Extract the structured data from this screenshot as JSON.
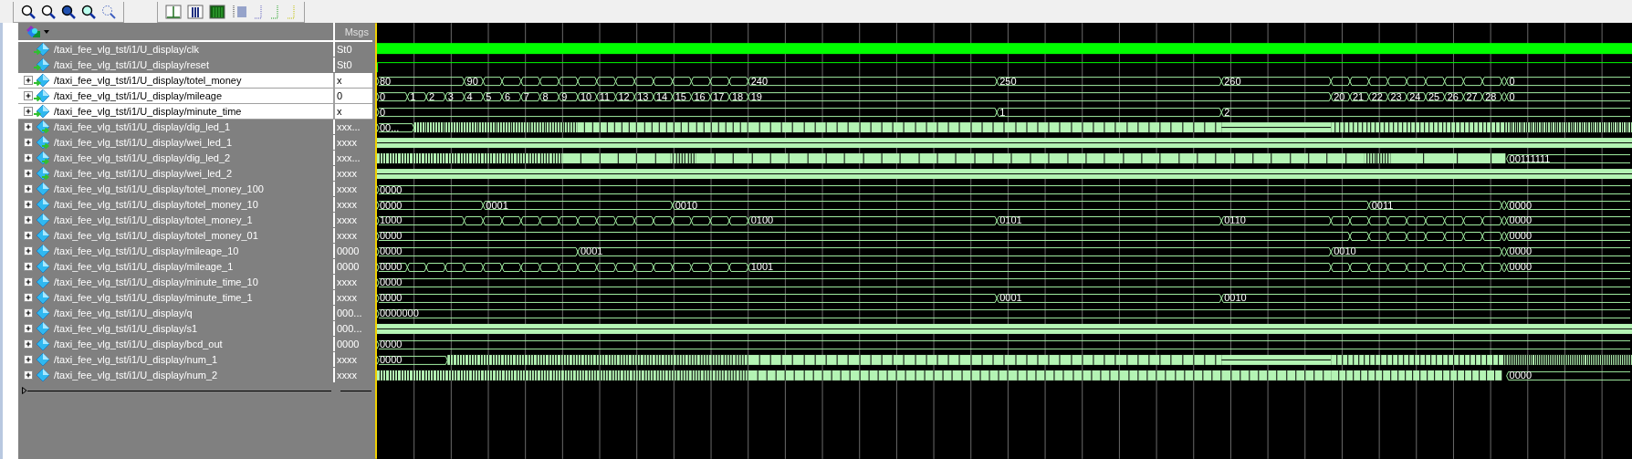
{
  "header": {
    "msgs_label": "Msgs"
  },
  "signals": [
    {
      "name": "/taxi_fee_vlg_tst/i1/U_display/clk",
      "value": "St0",
      "input": true,
      "output": false,
      "expandable": false,
      "selected": false,
      "kind": "clock"
    },
    {
      "name": "/taxi_fee_vlg_tst/i1/U_display/reset",
      "value": "St0",
      "input": true,
      "output": false,
      "expandable": false,
      "selected": false,
      "kind": "bit"
    },
    {
      "name": "/taxi_fee_vlg_tst/i1/U_display/totel_money",
      "value": "x",
      "input": true,
      "output": false,
      "expandable": true,
      "selected": true,
      "kind": "bus",
      "labels": [
        "80",
        "90",
        "240",
        "250",
        "260",
        "0"
      ]
    },
    {
      "name": "/taxi_fee_vlg_tst/i1/U_display/mileage",
      "value": "0",
      "input": true,
      "output": false,
      "expandable": true,
      "selected": true,
      "kind": "bus",
      "labels": [
        "0",
        "1",
        "2",
        "3",
        "4",
        "5",
        "6",
        "7",
        "8",
        "9",
        "10",
        "11",
        "12",
        "13",
        "14",
        "15",
        "16",
        "17",
        "18",
        "19",
        "20",
        "21",
        "22",
        "23",
        "24",
        "25",
        "26",
        "27",
        "28",
        "0"
      ]
    },
    {
      "name": "/taxi_fee_vlg_tst/i1/U_display/minute_time",
      "value": "x",
      "input": true,
      "output": false,
      "expandable": true,
      "selected": true,
      "kind": "bus",
      "labels": [
        "0",
        "1",
        "2"
      ]
    },
    {
      "name": "/taxi_fee_vlg_tst/i1/U_display/dig_led_1",
      "value": "xxx...",
      "input": false,
      "output": true,
      "expandable": true,
      "selected": false,
      "kind": "dense",
      "labels": [
        "00..."
      ]
    },
    {
      "name": "/taxi_fee_vlg_tst/i1/U_display/wei_led_1",
      "value": "xxxx",
      "input": false,
      "output": true,
      "expandable": true,
      "selected": false,
      "kind": "dense"
    },
    {
      "name": "/taxi_fee_vlg_tst/i1/U_display/dig_led_2",
      "value": "xxx...",
      "input": false,
      "output": true,
      "expandable": true,
      "selected": false,
      "kind": "dense",
      "labels": [
        "00111111"
      ]
    },
    {
      "name": "/taxi_fee_vlg_tst/i1/U_display/wei_led_2",
      "value": "xxxx",
      "input": false,
      "output": true,
      "expandable": true,
      "selected": false,
      "kind": "dense"
    },
    {
      "name": "/taxi_fee_vlg_tst/i1/U_display/totel_money_100",
      "value": "xxxx",
      "input": false,
      "output": false,
      "expandable": true,
      "selected": false,
      "kind": "bus",
      "labels": [
        "0000"
      ]
    },
    {
      "name": "/taxi_fee_vlg_tst/i1/U_display/totel_money_10",
      "value": "xxxx",
      "input": false,
      "output": false,
      "expandable": true,
      "selected": false,
      "kind": "bus",
      "labels": [
        "0000",
        "0001",
        "0010",
        "0011",
        "0000"
      ]
    },
    {
      "name": "/taxi_fee_vlg_tst/i1/U_display/totel_money_1",
      "value": "xxxx",
      "input": false,
      "output": false,
      "expandable": true,
      "selected": false,
      "kind": "bus",
      "labels": [
        "1000",
        "0100",
        "0101",
        "0110",
        "0000"
      ]
    },
    {
      "name": "/taxi_fee_vlg_tst/i1/U_display/totel_money_01",
      "value": "xxxx",
      "input": false,
      "output": false,
      "expandable": true,
      "selected": false,
      "kind": "bus",
      "labels": [
        "0000",
        "0000"
      ]
    },
    {
      "name": "/taxi_fee_vlg_tst/i1/U_display/mileage_10",
      "value": "0000",
      "input": false,
      "output": false,
      "expandable": true,
      "selected": false,
      "kind": "bus",
      "labels": [
        "0000",
        "0001",
        "0010",
        "0000"
      ]
    },
    {
      "name": "/taxi_fee_vlg_tst/i1/U_display/mileage_1",
      "value": "0000",
      "input": false,
      "output": false,
      "expandable": true,
      "selected": false,
      "kind": "bus",
      "labels": [
        "0000",
        "1001",
        "0000"
      ]
    },
    {
      "name": "/taxi_fee_vlg_tst/i1/U_display/minute_time_10",
      "value": "xxxx",
      "input": false,
      "output": false,
      "expandable": true,
      "selected": false,
      "kind": "bus",
      "labels": [
        "0000"
      ]
    },
    {
      "name": "/taxi_fee_vlg_tst/i1/U_display/minute_time_1",
      "value": "xxxx",
      "input": false,
      "output": false,
      "expandable": true,
      "selected": false,
      "kind": "bus",
      "labels": [
        "0000",
        "0001",
        "0010"
      ]
    },
    {
      "name": "/taxi_fee_vlg_tst/i1/U_display/q",
      "value": "000...",
      "input": false,
      "output": false,
      "expandable": true,
      "selected": false,
      "kind": "bus",
      "labels": [
        "0000000"
      ]
    },
    {
      "name": "/taxi_fee_vlg_tst/i1/U_display/s1",
      "value": "000...",
      "input": false,
      "output": false,
      "expandable": true,
      "selected": false,
      "kind": "dense"
    },
    {
      "name": "/taxi_fee_vlg_tst/i1/U_display/bcd_out",
      "value": "0000",
      "input": false,
      "output": false,
      "expandable": true,
      "selected": false,
      "kind": "bus",
      "labels": [
        "0000"
      ]
    },
    {
      "name": "/taxi_fee_vlg_tst/i1/U_display/num_1",
      "value": "xxxx",
      "input": false,
      "output": false,
      "expandable": true,
      "selected": false,
      "kind": "dense",
      "labels": [
        "0000"
      ]
    },
    {
      "name": "/taxi_fee_vlg_tst/i1/U_display/num_2",
      "value": "xxxx",
      "input": false,
      "output": false,
      "expandable": true,
      "selected": false,
      "kind": "dense",
      "labels": [
        "0000"
      ]
    }
  ]
}
